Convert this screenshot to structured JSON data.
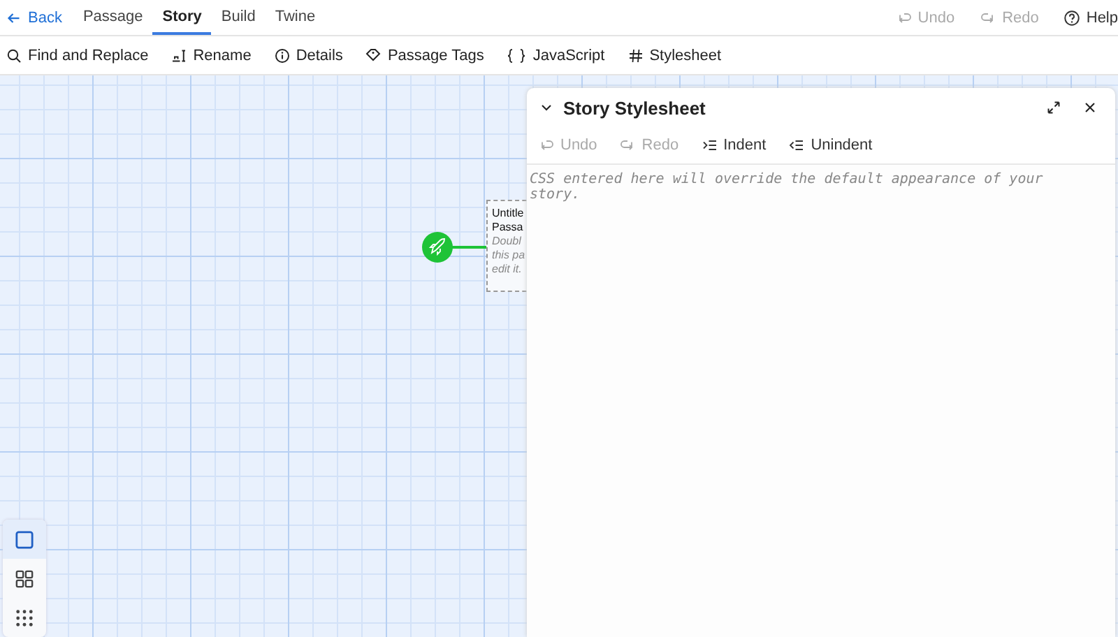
{
  "top_tabs": [
    {
      "label": "Passage",
      "selected": false
    },
    {
      "label": "Story",
      "selected": true
    },
    {
      "label": "Build",
      "selected": false
    },
    {
      "label": "Twine",
      "selected": false
    }
  ],
  "back": "Back",
  "top_actions": [
    {
      "label": "Undo",
      "disabled": true,
      "kind": "undo"
    },
    {
      "label": "Redo",
      "disabled": true,
      "kind": "redo"
    },
    {
      "label": "Help",
      "disabled": false,
      "kind": "help"
    }
  ],
  "toolbar": [
    {
      "label": "Find and Replace",
      "kind": "search"
    },
    {
      "label": "Rename",
      "kind": "rename"
    },
    {
      "label": "Details",
      "kind": "info"
    },
    {
      "label": "Passage Tags",
      "kind": "tag"
    },
    {
      "label": "JavaScript",
      "kind": "braces"
    },
    {
      "label": "Stylesheet",
      "kind": "hash"
    }
  ],
  "passage": {
    "lines": [
      "Untitle",
      "Passa"
    ],
    "excerpt": [
      "Doubl",
      "this pa",
      "edit it."
    ]
  },
  "zoom": [
    {
      "kind": "one",
      "selected": true
    },
    {
      "kind": "four",
      "selected": false
    },
    {
      "kind": "nine",
      "selected": false
    }
  ],
  "dialog": {
    "title": "Story Stylesheet",
    "actions": [
      {
        "label": "Undo",
        "disabled": true,
        "kind": "undo"
      },
      {
        "label": "Redo",
        "disabled": true,
        "kind": "redo"
      },
      {
        "label": "Indent",
        "disabled": false,
        "kind": "indent"
      },
      {
        "label": "Unindent",
        "disabled": false,
        "kind": "unindent"
      }
    ],
    "placeholder": "CSS entered here will override the default appearance of your story."
  }
}
